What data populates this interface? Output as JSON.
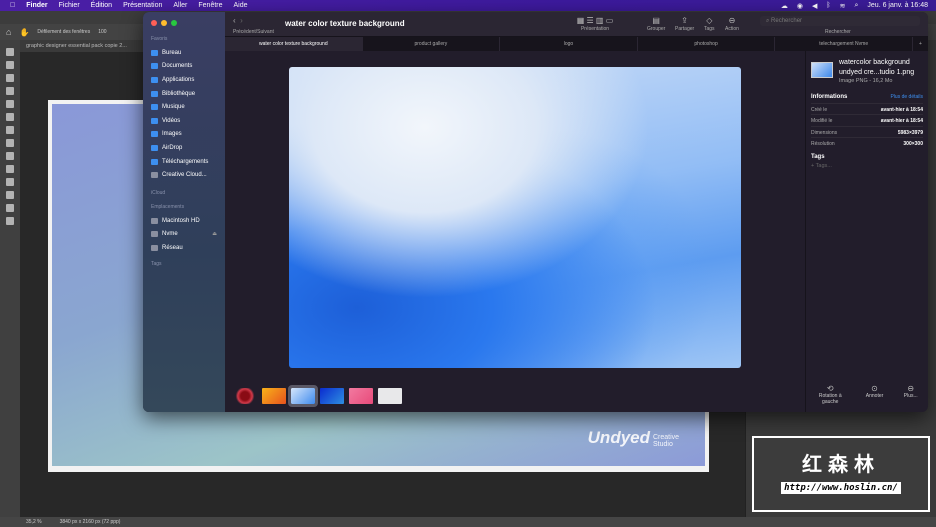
{
  "menubar": {
    "items": [
      "Finder",
      "Fichier",
      "Édition",
      "Présentation",
      "Aller",
      "Fenêtre",
      "Aide"
    ],
    "clock": "Jeu. 6 janv. à 16:48"
  },
  "photoshop": {
    "option": "Défilement des fenêtres",
    "zoom_field": "100",
    "doc_tab": "graphic designer essential pack copie 2...",
    "logo": "Undyed",
    "logo_sub": "Creative Studio",
    "zoom": "35,2 %",
    "doc_size": "3840 px x 2160 px (72 ppp)"
  },
  "finder": {
    "title": "water color texture background",
    "nav_label": "Précédent/Suivant",
    "toolbar": {
      "presentation": "Présentation",
      "group": "Grouper",
      "share": "Partager",
      "tags": "Tags",
      "action": "Action",
      "search_placeholder": "Rechercher",
      "search_label": "Rechercher"
    },
    "tabs": [
      "water color texture background",
      "product gallery",
      "logo",
      "photoshop",
      "telechargement Nvme"
    ],
    "sidebar": {
      "favorites_label": "Favoris",
      "favorites": [
        "Bureau",
        "Documents",
        "Applications",
        "Bibliothèque",
        "Musique",
        "Vidéos",
        "Images",
        "AirDrop",
        "Téléchargements",
        "Creative Cloud..."
      ],
      "icloud_label": "iCloud",
      "locations_label": "Emplacements",
      "locations": [
        "Macintosh HD",
        "Nvme",
        "Réseau"
      ],
      "tags_label": "Tags"
    },
    "info": {
      "name1": "watercolor background",
      "name2": "undyed cre...tudio 1.png",
      "kind": "Image PNG - 16,2 Mo",
      "section": "Informations",
      "more": "Plus de détails",
      "rows": [
        {
          "k": "Créé le",
          "v": "avant-hier à 18:54"
        },
        {
          "k": "Modifié le",
          "v": "avant-hier à 18:54"
        },
        {
          "k": "Dimensions",
          "v": "5983×3979"
        },
        {
          "k": "Résolution",
          "v": "300×300"
        }
      ],
      "tags_title": "Tags",
      "tags_placeholder": "+ Tags..."
    },
    "actions": [
      "Rotation à gauche",
      "Annoter",
      "Plus..."
    ]
  },
  "watermark": {
    "cn": "红森林",
    "url": "http://www.hoslin.cn/"
  }
}
